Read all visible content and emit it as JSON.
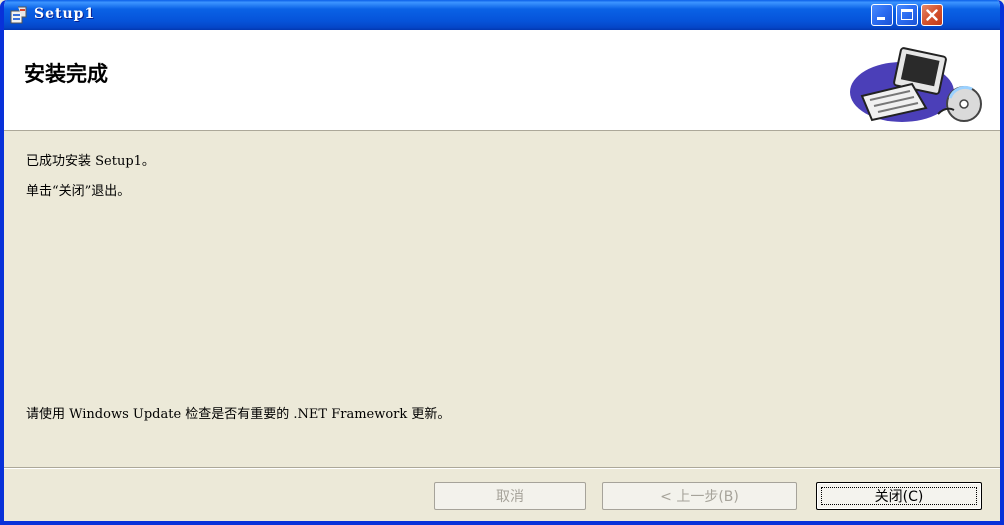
{
  "window": {
    "title": "Setup1",
    "titlebar_buttons": [
      "minimize-icon",
      "maximize-icon",
      "close-icon"
    ]
  },
  "header": {
    "title": "安装完成",
    "graphic": "computer-illustration"
  },
  "body": {
    "line1": "已成功安装 Setup1。",
    "line2": "单击“关闭”退出。",
    "update_notice": "请使用 Windows Update 检查是否有重要的 .NET Framework 更新。"
  },
  "buttons": {
    "cancel": "取消",
    "back": "< 上一步(B)",
    "close": "关闭(C)"
  },
  "colors": {
    "titlebar": "#0653D9",
    "dialog_bg": "#ECE9D8",
    "disabled_text": "#A6A39A"
  }
}
